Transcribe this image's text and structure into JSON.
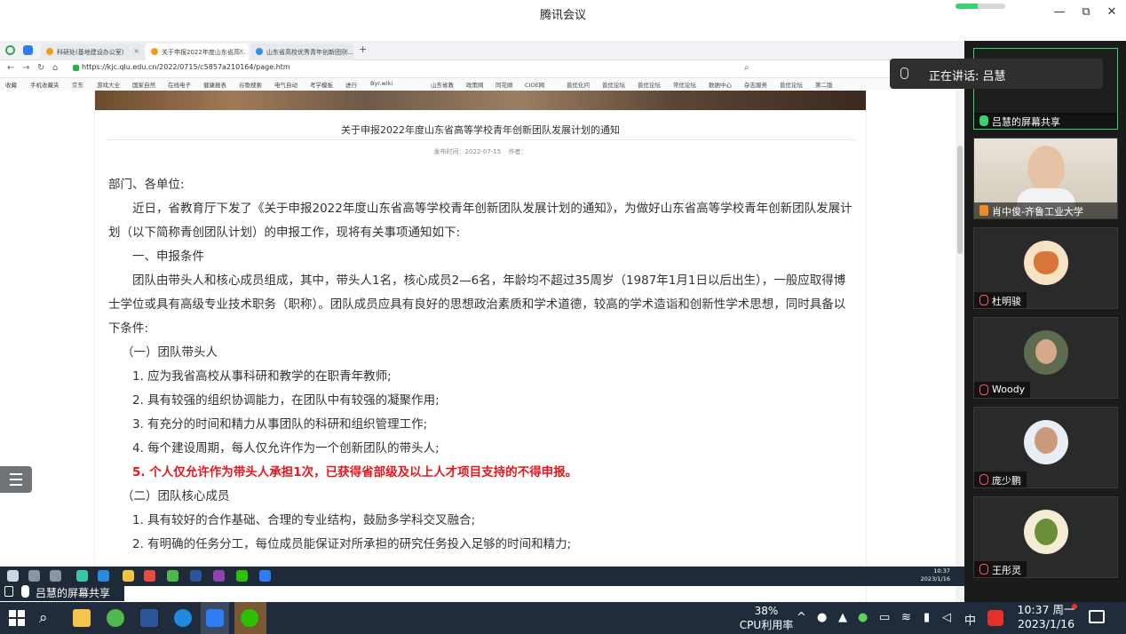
{
  "app": {
    "title": "腾讯会议",
    "minimize_label": "—",
    "maximize_label": "⧉",
    "close_label": "✕",
    "progress": 0.45
  },
  "browser": {
    "tabs": [
      {
        "label": "科研处(基地建设办公室)"
      },
      {
        "label": "关于申报2022年度山东省高..."
      },
      {
        "label": "山东省高校优秀青年创新团队..."
      }
    ],
    "url": "https://kjc.qlu.edu.cn/2022/0715/c5857a210164/page.htm",
    "bookmarks": [
      "收藏",
      "手机收藏夹",
      "京东",
      "游戏大全",
      "国家自然",
      "在线电子",
      "健康报表",
      "谷歌搜索",
      "电气自动",
      "考学模板",
      "进行",
      "Byr.wiki",
      "山东省教",
      "政策网",
      "同花顺",
      "CIOE网",
      "普优化问",
      "普优论坛",
      "普优论坛",
      "常优论坛",
      "数据中心",
      "杂志服务",
      "普优论坛",
      "第二版"
    ]
  },
  "article": {
    "title": "关于申报2022年度山东省高等学校青年创新团队发展计划的通知",
    "publish_label": "发布时间：2022-07-15",
    "author_label": "作者：",
    "paragraphs": [
      "部门、各单位:",
      "近日，省教育厅下发了《关于申报2022年度山东省高等学校青年创新团队发展计划的通知》，为做好山东省高等学校青年创新团队发展计划（以下简称青创团队计划）的申报工作，现将有关事项通知如下:",
      "一、申报条件",
      "团队由带头人和核心成员组成，其中，带头人1名，核心成员2—6名，年龄均不超过35周岁（1987年1月1日以后出生），一般应取得博士学位或具有高级专业技术职务（职称）。团队成员应具有良好的思想政治素质和学术道德，较高的学术造诣和创新性学术思想，同时具备以下条件:",
      "（一）团队带头人",
      "1. 应为我省高校从事科研和教学的在职青年教师;",
      "2. 具有较强的组织协调能力，在团队中有较强的凝聚作用;",
      "3. 有充分的时间和精力从事团队的科研和组织管理工作;",
      "4. 每个建设周期，每人仅允许作为一个创新团队的带头人;",
      "5. 个人仅允许作为带头人承担1次，已获得省部级及以上人才项目支持的不得申报。",
      "（二）团队核心成员",
      "1. 具有较好的合作基础、合理的专业结构，鼓励多学科交叉融合;",
      "2. 有明确的任务分工，每位成员能保证对所承担的研究任务投入足够的时间和精力;"
    ]
  },
  "inner_taskbar": {
    "time": "10:37",
    "date": "2023/1/16"
  },
  "share_strip": {
    "label": "吕慧的屏幕共享"
  },
  "speaking": {
    "label": "正在讲话: 吕慧"
  },
  "participants": [
    {
      "name": "吕慧的屏幕共享"
    },
    {
      "name": "肖中俊-齐鲁工业大学"
    },
    {
      "name": "杜明骏"
    },
    {
      "name": "Woody"
    },
    {
      "name": "庞少鹏"
    },
    {
      "name": "王彤灵"
    }
  ],
  "taskbar": {
    "cpu_percent": "38%",
    "cpu_label": "CPU利用率",
    "ime": "中",
    "time": "10:37 周一",
    "date": "2023/1/16"
  },
  "colors": {
    "accent_red": "#e8161b",
    "taskbar": "#202c3c",
    "panel": "#1b1b1b"
  }
}
